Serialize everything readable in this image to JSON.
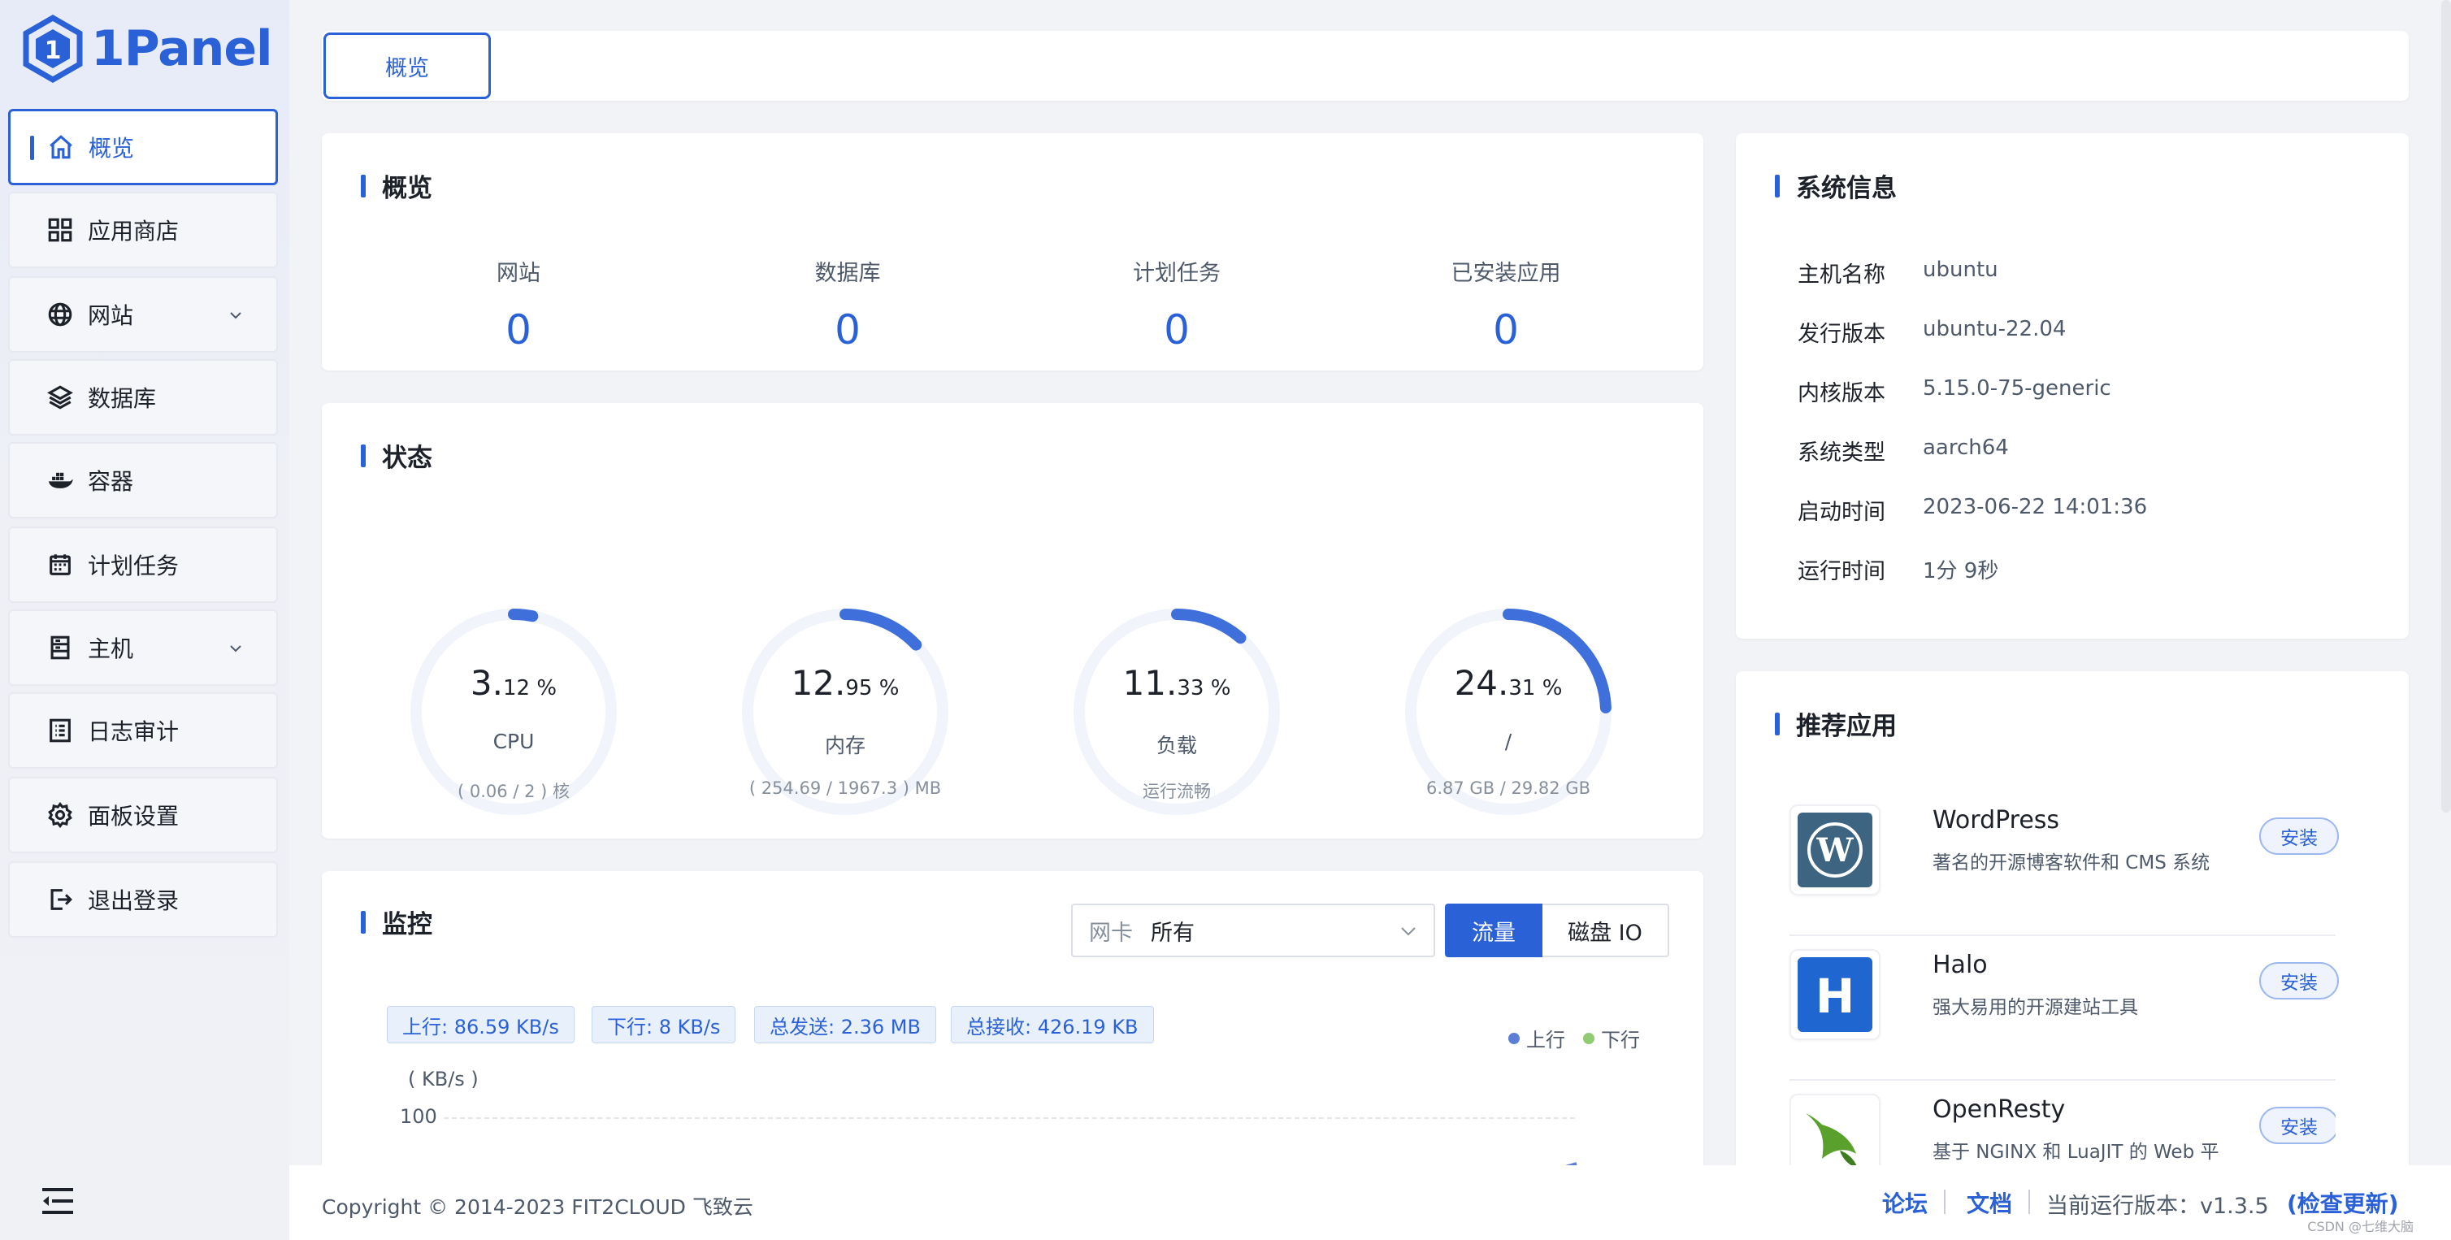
{
  "logo": {
    "text": "1Panel"
  },
  "sidebar": {
    "items": [
      {
        "label": "概览",
        "icon": "home-icon"
      },
      {
        "label": "应用商店",
        "icon": "grid-icon"
      },
      {
        "label": "网站",
        "icon": "globe-icon"
      },
      {
        "label": "数据库",
        "icon": "layers-icon"
      },
      {
        "label": "容器",
        "icon": "docker-icon"
      },
      {
        "label": "计划任务",
        "icon": "calendar-icon"
      },
      {
        "label": "主机",
        "icon": "server-icon"
      },
      {
        "label": "日志审计",
        "icon": "log-icon"
      },
      {
        "label": "面板设置",
        "icon": "gear-icon"
      },
      {
        "label": "退出登录",
        "icon": "logout-icon"
      }
    ]
  },
  "tabs": {
    "overview": "概览"
  },
  "overview": {
    "title": "概览",
    "stats": [
      {
        "label": "网站",
        "value": "0"
      },
      {
        "label": "数据库",
        "value": "0"
      },
      {
        "label": "计划任务",
        "value": "0"
      },
      {
        "label": "已安装应用",
        "value": "0"
      }
    ]
  },
  "status": {
    "title": "状态",
    "gauges": [
      {
        "big": "3.",
        "small": "12 %",
        "label": "CPU",
        "footer": "( 0.06 / 2 ) 核",
        "percent": 3.12
      },
      {
        "big": "12.",
        "small": "95 %",
        "label": "内存",
        "footer": "( 254.69 / 1967.3 ) MB",
        "percent": 12.95
      },
      {
        "big": "11.",
        "small": "33 %",
        "label": "负载",
        "footer": "运行流畅",
        "percent": 11.33
      },
      {
        "big": "24.",
        "small": "31 %",
        "label": "/",
        "footer": "6.87 GB / 29.82 GB",
        "percent": 24.31
      }
    ]
  },
  "monitor": {
    "title": "监控",
    "nic_label": "网卡",
    "nic_value": "所有",
    "btn_traffic": "流量",
    "btn_disk": "磁盘 IO",
    "chips": [
      "上行: 86.59 KB/s",
      "下行: 8 KB/s",
      "总发送: 2.36 MB",
      "总接收: 426.19 KB"
    ],
    "legend_up": "上行",
    "legend_down": "下行",
    "unit": "( KB/s )",
    "y_tick": "100",
    "colors": {
      "up": "#5b7fd6",
      "down": "#91cc75"
    }
  },
  "sysinfo": {
    "title": "系统信息",
    "rows": [
      {
        "k": "主机名称",
        "v": "ubuntu"
      },
      {
        "k": "发行版本",
        "v": "ubuntu-22.04"
      },
      {
        "k": "内核版本",
        "v": "5.15.0-75-generic"
      },
      {
        "k": "系统类型",
        "v": "aarch64"
      },
      {
        "k": "启动时间",
        "v": "2023-06-22 14:01:36"
      },
      {
        "k": "运行时间",
        "v": "1分 9秒"
      }
    ]
  },
  "recommend": {
    "title": "推荐应用",
    "apps": [
      {
        "name": "WordPress",
        "desc": "著名的开源博客软件和 CMS 系统",
        "install": "安装"
      },
      {
        "name": "Halo",
        "desc": "强大易用的开源建站工具",
        "install": "安装"
      },
      {
        "name": "OpenResty",
        "desc": "基于 NGINX 和 LuaJIT 的 Web 平",
        "install": "安装"
      }
    ]
  },
  "footer": {
    "copyright": "Copyright © 2014-2023 FIT2CLOUD 飞致云",
    "forum": "论坛",
    "docs": "文档",
    "version": "当前运行版本：v1.3.5",
    "check_update": "(检查更新)",
    "watermark": "CSDN @七维大脑"
  },
  "accent_color": "#2b61d6"
}
